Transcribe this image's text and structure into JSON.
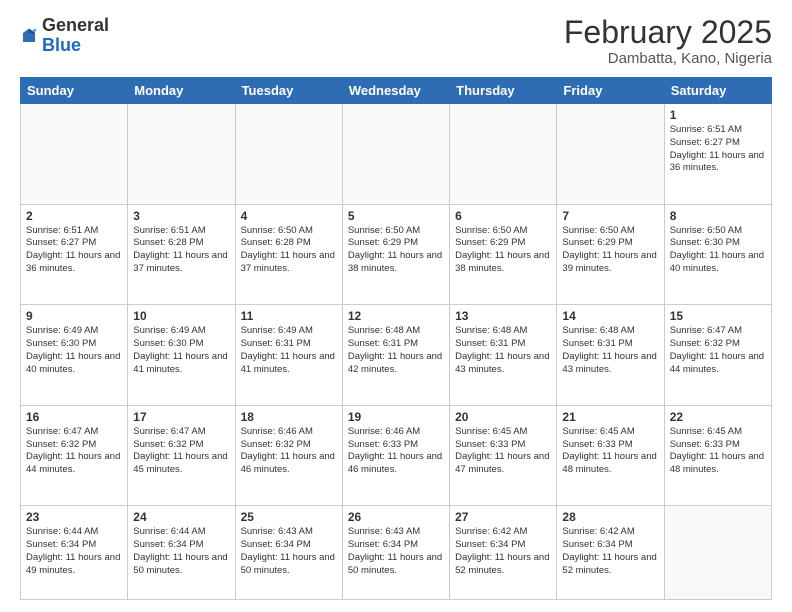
{
  "header": {
    "logo_general": "General",
    "logo_blue": "Blue",
    "month_title": "February 2025",
    "location": "Dambatta, Kano, Nigeria"
  },
  "days_of_week": [
    "Sunday",
    "Monday",
    "Tuesday",
    "Wednesday",
    "Thursday",
    "Friday",
    "Saturday"
  ],
  "weeks": [
    [
      {
        "day": "",
        "info": ""
      },
      {
        "day": "",
        "info": ""
      },
      {
        "day": "",
        "info": ""
      },
      {
        "day": "",
        "info": ""
      },
      {
        "day": "",
        "info": ""
      },
      {
        "day": "",
        "info": ""
      },
      {
        "day": "1",
        "info": "Sunrise: 6:51 AM\nSunset: 6:27 PM\nDaylight: 11 hours\nand 36 minutes."
      }
    ],
    [
      {
        "day": "2",
        "info": "Sunrise: 6:51 AM\nSunset: 6:27 PM\nDaylight: 11 hours\nand 36 minutes."
      },
      {
        "day": "3",
        "info": "Sunrise: 6:51 AM\nSunset: 6:28 PM\nDaylight: 11 hours\nand 37 minutes."
      },
      {
        "day": "4",
        "info": "Sunrise: 6:50 AM\nSunset: 6:28 PM\nDaylight: 11 hours\nand 37 minutes."
      },
      {
        "day": "5",
        "info": "Sunrise: 6:50 AM\nSunset: 6:29 PM\nDaylight: 11 hours\nand 38 minutes."
      },
      {
        "day": "6",
        "info": "Sunrise: 6:50 AM\nSunset: 6:29 PM\nDaylight: 11 hours\nand 38 minutes."
      },
      {
        "day": "7",
        "info": "Sunrise: 6:50 AM\nSunset: 6:29 PM\nDaylight: 11 hours\nand 39 minutes."
      },
      {
        "day": "8",
        "info": "Sunrise: 6:50 AM\nSunset: 6:30 PM\nDaylight: 11 hours\nand 40 minutes."
      }
    ],
    [
      {
        "day": "9",
        "info": "Sunrise: 6:49 AM\nSunset: 6:30 PM\nDaylight: 11 hours\nand 40 minutes."
      },
      {
        "day": "10",
        "info": "Sunrise: 6:49 AM\nSunset: 6:30 PM\nDaylight: 11 hours\nand 41 minutes."
      },
      {
        "day": "11",
        "info": "Sunrise: 6:49 AM\nSunset: 6:31 PM\nDaylight: 11 hours\nand 41 minutes."
      },
      {
        "day": "12",
        "info": "Sunrise: 6:48 AM\nSunset: 6:31 PM\nDaylight: 11 hours\nand 42 minutes."
      },
      {
        "day": "13",
        "info": "Sunrise: 6:48 AM\nSunset: 6:31 PM\nDaylight: 11 hours\nand 43 minutes."
      },
      {
        "day": "14",
        "info": "Sunrise: 6:48 AM\nSunset: 6:31 PM\nDaylight: 11 hours\nand 43 minutes."
      },
      {
        "day": "15",
        "info": "Sunrise: 6:47 AM\nSunset: 6:32 PM\nDaylight: 11 hours\nand 44 minutes."
      }
    ],
    [
      {
        "day": "16",
        "info": "Sunrise: 6:47 AM\nSunset: 6:32 PM\nDaylight: 11 hours\nand 44 minutes."
      },
      {
        "day": "17",
        "info": "Sunrise: 6:47 AM\nSunset: 6:32 PM\nDaylight: 11 hours\nand 45 minutes."
      },
      {
        "day": "18",
        "info": "Sunrise: 6:46 AM\nSunset: 6:32 PM\nDaylight: 11 hours\nand 46 minutes."
      },
      {
        "day": "19",
        "info": "Sunrise: 6:46 AM\nSunset: 6:33 PM\nDaylight: 11 hours\nand 46 minutes."
      },
      {
        "day": "20",
        "info": "Sunrise: 6:45 AM\nSunset: 6:33 PM\nDaylight: 11 hours\nand 47 minutes."
      },
      {
        "day": "21",
        "info": "Sunrise: 6:45 AM\nSunset: 6:33 PM\nDaylight: 11 hours\nand 48 minutes."
      },
      {
        "day": "22",
        "info": "Sunrise: 6:45 AM\nSunset: 6:33 PM\nDaylight: 11 hours\nand 48 minutes."
      }
    ],
    [
      {
        "day": "23",
        "info": "Sunrise: 6:44 AM\nSunset: 6:34 PM\nDaylight: 11 hours\nand 49 minutes."
      },
      {
        "day": "24",
        "info": "Sunrise: 6:44 AM\nSunset: 6:34 PM\nDaylight: 11 hours\nand 50 minutes."
      },
      {
        "day": "25",
        "info": "Sunrise: 6:43 AM\nSunset: 6:34 PM\nDaylight: 11 hours\nand 50 minutes."
      },
      {
        "day": "26",
        "info": "Sunrise: 6:43 AM\nSunset: 6:34 PM\nDaylight: 11 hours\nand 50 minutes."
      },
      {
        "day": "27",
        "info": "Sunrise: 6:42 AM\nSunset: 6:34 PM\nDaylight: 11 hours\nand 52 minutes."
      },
      {
        "day": "28",
        "info": "Sunrise: 6:42 AM\nSunset: 6:34 PM\nDaylight: 11 hours\nand 52 minutes."
      },
      {
        "day": "",
        "info": ""
      }
    ]
  ]
}
